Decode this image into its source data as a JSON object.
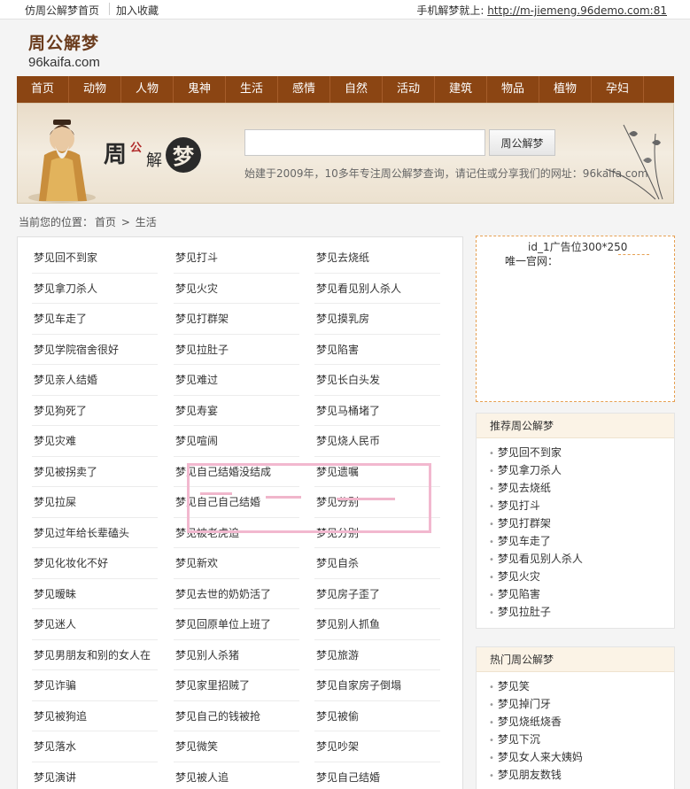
{
  "topbar": {
    "home_link": "仿周公解梦首页",
    "favorite_link": "加入收藏",
    "mobile_label": "手机解梦就上:",
    "mobile_url": "http://m-jiemeng.96demo.com:81"
  },
  "logo": {
    "cn": "周公解梦",
    "en": "96kaifa.com"
  },
  "nav": [
    "首页",
    "动物",
    "人物",
    "鬼神",
    "生活",
    "感情",
    "自然",
    "活动",
    "建筑",
    "物品",
    "植物",
    "孕妇"
  ],
  "banner": {
    "title": "周公解梦",
    "search_placeholder": "",
    "search_button": "周公解梦",
    "tagline": "始建于2009年，10多年专注周公解梦查询，请记住或分享我们的网址：96kaifa.com"
  },
  "breadcrumb": {
    "prefix": "当前您的位置：",
    "home": "首页",
    "sep": ">",
    "current": "生活"
  },
  "dreams": [
    "梦见回不到家",
    "梦见打斗",
    "梦见去烧纸",
    "梦见拿刀杀人",
    "梦见火灾",
    "梦见看见别人杀人",
    "梦见车走了",
    "梦见打群架",
    "梦见摸乳房",
    "梦见学院宿舍很好",
    "梦见拉肚子",
    "梦见陷害",
    "梦见亲人结婚",
    "梦见难过",
    "梦见长白头发",
    "梦见狗死了",
    "梦见寿宴",
    "梦见马桶堵了",
    "梦见灾难",
    "梦见喧闹",
    "梦见烧人民币",
    "梦见被拐卖了",
    "梦见自己结婚没结成",
    "梦见遗嘱",
    "梦见拉屎",
    "梦见自己自己结婚",
    "梦见分别",
    "梦见过年给长辈磕头",
    "梦见被老虎追",
    "梦见分别",
    "梦见化妆化不好",
    "梦见新欢",
    "梦见自杀",
    "梦见暧昧",
    "梦见去世的奶奶活了",
    "梦见房子歪了",
    "梦见迷人",
    "梦见回原单位上班了",
    "梦见别人抓鱼",
    "梦见男朋友和别的女人在",
    "梦见别人杀猪",
    "梦见旅游",
    "梦见诈骗",
    "梦见家里招贼了",
    "梦见自家房子倒塌",
    "梦见被狗追",
    "梦见自己的钱被抢",
    "梦见被偷",
    "梦见落水",
    "梦见微笑",
    "梦见吵架",
    "梦见演讲",
    "梦见被人追",
    "梦见自己结婚"
  ],
  "ad": {
    "line1": "id_1广告位300*250",
    "line2": "唯一官网："
  },
  "recommend": {
    "title": "推荐周公解梦",
    "items": [
      "梦见回不到家",
      "梦见拿刀杀人",
      "梦见去烧纸",
      "梦见打斗",
      "梦见打群架",
      "梦见车走了",
      "梦见看见别人杀人",
      "梦见火灾",
      "梦见陷害",
      "梦见拉肚子"
    ]
  },
  "hot": {
    "title": "热门周公解梦",
    "items": [
      "梦见笑",
      "梦见掉门牙",
      "梦见烧纸烧香",
      "梦见下沉",
      "梦见女人来大姨妈",
      "梦见朋友数钱"
    ]
  },
  "colors": {
    "nav_bg": "#8b4513",
    "brand": "#6b3c1d",
    "ad_border": "#e6a052",
    "watermark": "#f2b8cf"
  }
}
